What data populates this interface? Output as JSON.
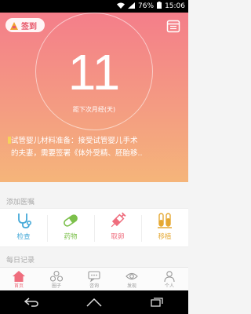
{
  "status_bar": {
    "battery": "76%",
    "time": "15:06"
  },
  "header": {
    "checkin_label": "签到",
    "days_count": "11",
    "days_caption": "距下次月经(天)"
  },
  "notice": {
    "line1": "试管婴儿材料准备：接受试管婴儿手术",
    "line2": "的夫妻，需要签署《体外受精、胚胎移.."
  },
  "reminders": {
    "title": "添加医嘱",
    "items": [
      {
        "label": "检查",
        "icon": "stethoscope-icon",
        "color": "#45a9d8"
      },
      {
        "label": "药物",
        "icon": "pill-icon",
        "color": "#7cc04b"
      },
      {
        "label": "取卵",
        "icon": "syringe-icon",
        "color": "#ef6d7d"
      },
      {
        "label": "移植",
        "icon": "test-tubes-icon",
        "color": "#e5a832"
      }
    ]
  },
  "daily": {
    "title": "每日记录"
  },
  "tabs": [
    {
      "label": "首页",
      "icon": "home-icon"
    },
    {
      "label": "圈子",
      "icon": "circle-icon"
    },
    {
      "label": "咨询",
      "icon": "chat-icon"
    },
    {
      "label": "发现",
      "icon": "eye-icon"
    },
    {
      "label": "个人",
      "icon": "person-icon"
    }
  ],
  "colors": {
    "accent": "#ef6d7d",
    "hero_top": "#f47e8a",
    "hero_bottom": "#f5b57a"
  }
}
